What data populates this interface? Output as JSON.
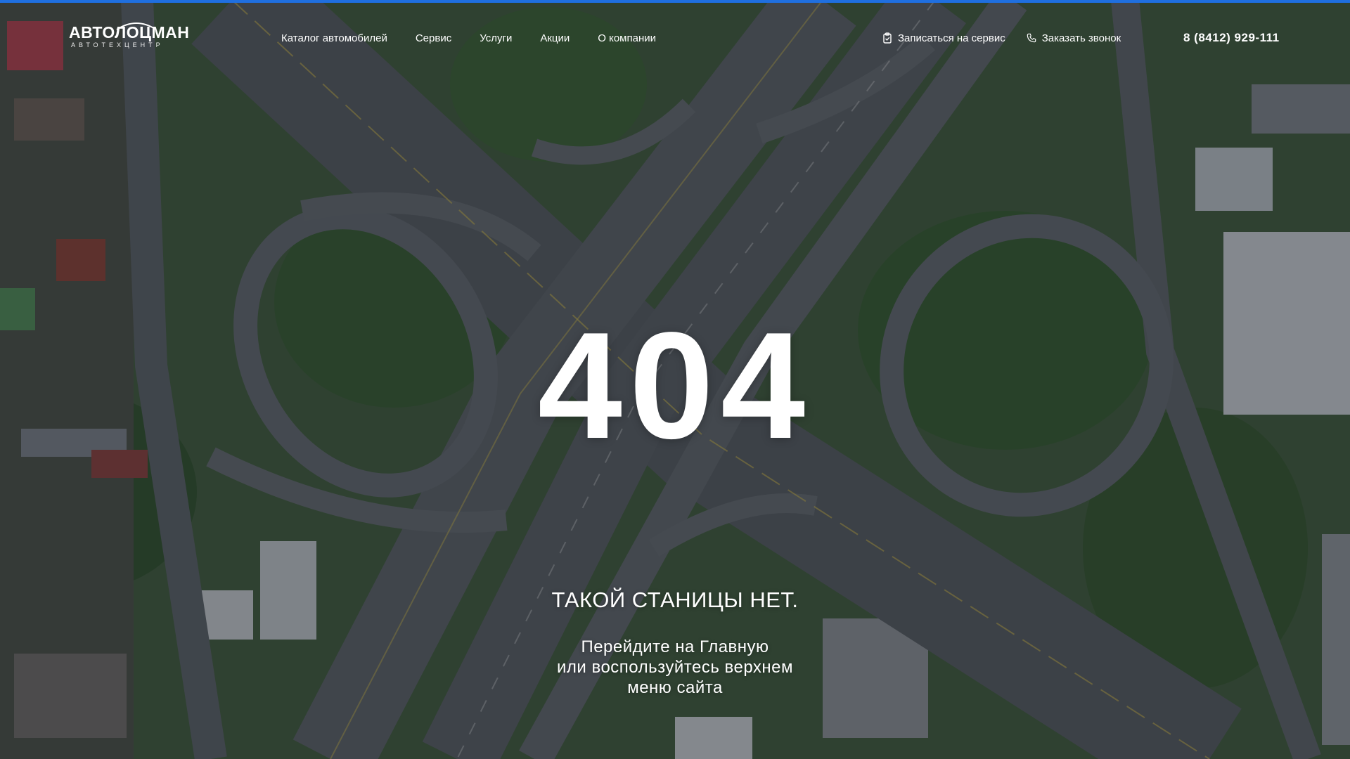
{
  "colors": {
    "accent": "#1f6fe0",
    "text": "#ffffff",
    "overlay": "#141a22"
  },
  "header": {
    "logo": {
      "name": "АВТОЛОЦМАН",
      "tagline": "АВТОТЕХЦЕНТР"
    },
    "nav": [
      {
        "label": "Каталог автомобилей"
      },
      {
        "label": "Сервис"
      },
      {
        "label": "Услуги"
      },
      {
        "label": "Акции"
      },
      {
        "label": "О компании"
      }
    ],
    "actions": {
      "service_signup": {
        "label": "Записаться на сервис",
        "icon": "clipboard-icon"
      },
      "callback": {
        "label": "Заказать звонок",
        "icon": "phone-icon"
      }
    },
    "phone": "8 (8412) 929-111"
  },
  "error": {
    "code": "404",
    "title": "ТАКОЙ СТАНИЦЫ НЕТ.",
    "message_lines": [
      "Перейдите на Главную",
      "или воспользуйтесь верхнем",
      "меню сайта"
    ]
  }
}
